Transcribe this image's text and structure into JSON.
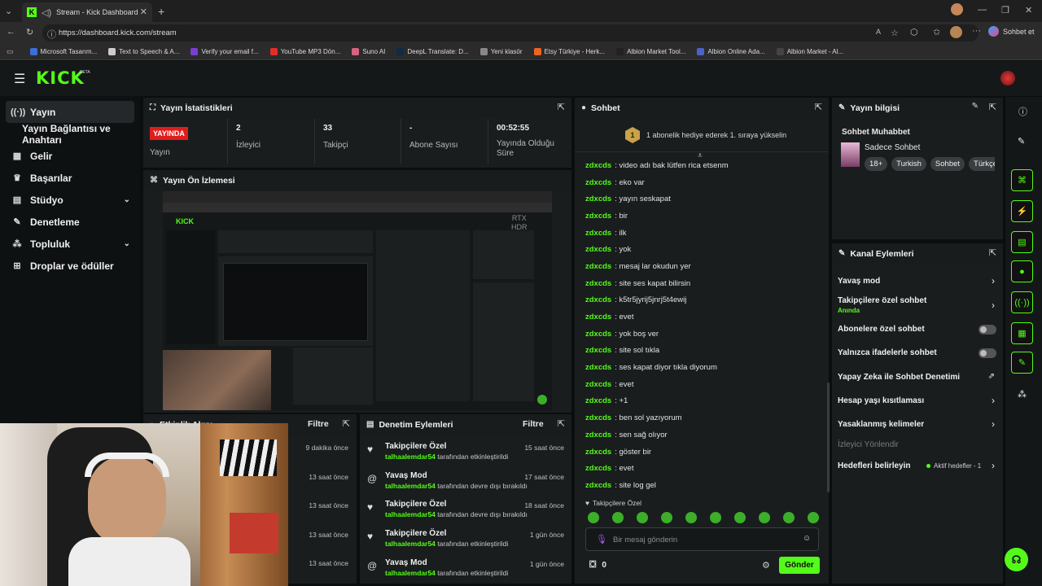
{
  "browser": {
    "tab_title": "Stream - Kick Dashboard",
    "url": "https://dashboard.kick.com/stream",
    "sohbet_et": "Sohbet et",
    "bookmarks": [
      {
        "label": "Microsoft Tasarım...",
        "color": "#3b6fd8"
      },
      {
        "label": "Text to Speech & A...",
        "color": "#cccccc"
      },
      {
        "label": "Verify your email f...",
        "color": "#7a3fd0"
      },
      {
        "label": "YouTube MP3 Dön...",
        "color": "#e52d27"
      },
      {
        "label": "Suno AI",
        "color": "#d9627f"
      },
      {
        "label": "DeepL Translate: D...",
        "color": "#0f2b46"
      },
      {
        "label": "Yeni klasör",
        "color": "#888888"
      },
      {
        "label": "Etsy Türkiye - Herk...",
        "color": "#f1641e"
      },
      {
        "label": "Albion Market Tool...",
        "color": "#222222"
      },
      {
        "label": "Albion Online Ada...",
        "color": "#4a63c9"
      },
      {
        "label": "Albion Market - Al...",
        "color": "#444444"
      }
    ]
  },
  "kick": {
    "logo": "KICK",
    "beta": "BETA",
    "accent": "#53fc18"
  },
  "sidebar": {
    "items": [
      {
        "label": "Yayın",
        "icon": "broadcast-icon"
      },
      {
        "label": "Yayın Bağlantısı ve Anahtarı",
        "icon": ""
      },
      {
        "label": "Gelir",
        "icon": "revenue-icon"
      },
      {
        "label": "Başarılar",
        "icon": "trophy-icon"
      },
      {
        "label": "Stüdyo",
        "icon": "studio-icon"
      },
      {
        "label": "Denetleme",
        "icon": "wrench-icon"
      },
      {
        "label": "Topluluk",
        "icon": "community-icon"
      },
      {
        "label": "Droplar ve ödüller",
        "icon": "drops-icon"
      }
    ]
  },
  "stats": {
    "title": "Yayın İstatistikleri",
    "live_badge": "YAYINDA",
    "live_label": "Yayın",
    "viewers_value": "2",
    "viewers_label": "İzleyici",
    "followers_value": "33",
    "followers_label": "Takipçi",
    "subs_value": "-",
    "subs_label": "Abone Sayısı",
    "uptime_value": "00:52:55",
    "uptime_label": "Yayında Olduğu Süre"
  },
  "preview": {
    "title": "Yayın Ön İzlemesi",
    "rtx": "RTX",
    "hdr": "HDR"
  },
  "activity": {
    "title": "Etkinlik Akışı",
    "filter": "Filtre",
    "times": [
      "9 dakika önce",
      "13 saat önce",
      "13 saat önce",
      "13 saat önce",
      "13 saat önce"
    ]
  },
  "moderation": {
    "title": "Denetim Eylemleri",
    "filter": "Filtre",
    "items": [
      {
        "title": "Takipçilere Özel",
        "user": "talhaalemdar54",
        "action": "tarafından etkinleştirildi",
        "time": "15 saat önce",
        "icon": "heart-icon"
      },
      {
        "title": "Yavaş Mod",
        "user": "talhaalemdar54",
        "action": "tarafından devre dışı bırakıldı",
        "time": "17 saat önce",
        "icon": "snail-icon"
      },
      {
        "title": "Takipçilere Özel",
        "user": "talhaalemdar54",
        "action": "tarafından devre dışı bırakıldı",
        "time": "18 saat önce",
        "icon": "heart-icon"
      },
      {
        "title": "Takipçilere Özel",
        "user": "talhaalemdar54",
        "action": "tarafından etkinleştirildi",
        "time": "1 gün önce",
        "icon": "heart-icon"
      },
      {
        "title": "Yavaş Mod",
        "user": "talhaalemdar54",
        "action": "tarafından etkinleştirildi",
        "time": "1 gün önce",
        "icon": "snail-icon"
      }
    ]
  },
  "chat": {
    "title": "Sohbet",
    "gift_banner": "1 abonelik hediye ederek 1. sıraya yükselin",
    "gift_rank": "1",
    "messages": [
      {
        "user": "zdxcds",
        "text": "video adı bak lütfen rica etsenm"
      },
      {
        "user": "zdxcds",
        "text": "eko var"
      },
      {
        "user": "zdxcds",
        "text": "yayın seskapat"
      },
      {
        "user": "zdxcds",
        "text": "bir"
      },
      {
        "user": "zdxcds",
        "text": "ilk"
      },
      {
        "user": "zdxcds",
        "text": "yok"
      },
      {
        "user": "zdxcds",
        "text": "mesaj lar okudun yer"
      },
      {
        "user": "zdxcds",
        "text": "site ses kapat bilirsin"
      },
      {
        "user": "zdxcds",
        "text": "k5tr5jyrij5jnrj5t4ewij"
      },
      {
        "user": "zdxcds",
        "text": "evet"
      },
      {
        "user": "zdxcds",
        "text": "yok boş ver"
      },
      {
        "user": "zdxcds",
        "text": "site sol tıkla"
      },
      {
        "user": "zdxcds",
        "text": "ses kapat diyor tıkla diyorum"
      },
      {
        "user": "zdxcds",
        "text": "evet"
      },
      {
        "user": "zdxcds",
        "text": "+1"
      },
      {
        "user": "zdxcds",
        "text": "ben sol yazıyorum"
      },
      {
        "user": "zdxcds",
        "text": "sen sağ olıyor"
      },
      {
        "user": "zdxcds",
        "text": "göster bir"
      },
      {
        "user": "zdxcds",
        "text": "evet"
      },
      {
        "user": "zdxcds",
        "text": "site log gel"
      }
    ],
    "mode_label": "Takipçilere Özel",
    "input_placeholder": "Bir mesaj gönderin",
    "points": "0",
    "send_label": "Gönder"
  },
  "stream_info": {
    "title": "Yayın bilgisi",
    "stream_title": "Sohbet Muhabbet",
    "category": "Sadece Sohbet",
    "tags": [
      "18+",
      "Turkish",
      "Sohbet",
      "Türkçe"
    ]
  },
  "channel_actions": {
    "title": "Kanal Eylemleri",
    "slow_mode": "Yavaş mod",
    "followers_only": "Takipçilere özel sohbet",
    "followers_only_sub": "Anında",
    "subs_only": "Abonelere özel sohbet",
    "emote_only": "Yalnızca ifadelerle sohbet",
    "ai_moderation": "Yapay Zeka ile Sohbet Denetimi",
    "account_age": "Hesap yaşı kısıtlaması",
    "banned_words": "Yasaklanmış kelimeler",
    "viewer_redirect": "İzleyici Yönlendir",
    "set_goals": "Hedefleri belirleyin",
    "goals_status": "Aktif hedefler - 1"
  }
}
